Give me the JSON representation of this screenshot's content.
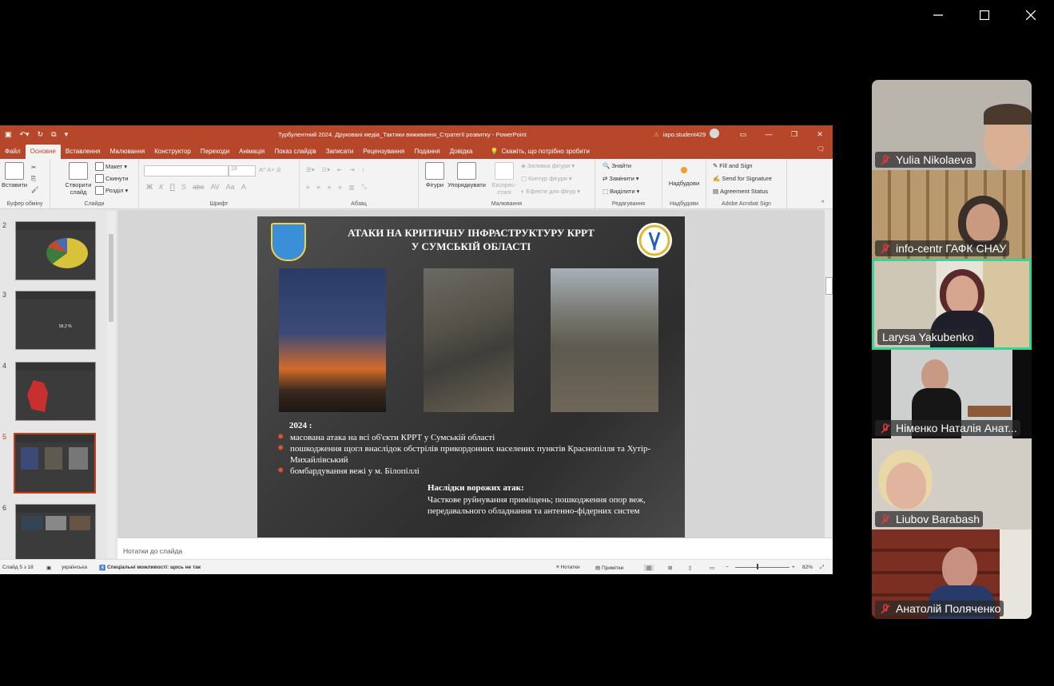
{
  "app": {
    "document_title": "Турбулентний 2024. Друковані медіа_Тактики виживання_Стратегії розвитку  -  PowerPoint",
    "user": "iapo.student429",
    "warning": "⚠"
  },
  "tabs": [
    "Файл",
    "Основне",
    "Вставлення",
    "Малювання",
    "Конструктор",
    "Переходи",
    "Анімація",
    "Показ слайдів",
    "Записати",
    "Рецензування",
    "Подання",
    "Довідка"
  ],
  "tell_me": "Скажіть, що потрібно зробити",
  "ribbon": {
    "clipboard": {
      "paste": "Вставити",
      "group": "Буфер обміну"
    },
    "slides": {
      "new": "Створити слайд",
      "layout": "Макет",
      "reset": "Скинути",
      "section": "Розділ",
      "group": "Слайди"
    },
    "font": {
      "size": "18",
      "bold": "Ж",
      "italic": "К",
      "underline": "П",
      "shadow": "S",
      "strike": "abc",
      "group": "Шрифт"
    },
    "paragraph": {
      "group": "Абзац"
    },
    "drawing": {
      "shapes": "Фігури",
      "arrange": "Упорядкувати",
      "quick_styles": "Експрес-стилі",
      "fill": "Заливка фігури",
      "outline": "Контур фігури",
      "effects": "Ефекти для фігур",
      "group": "Малювання"
    },
    "editing": {
      "find": "Знайти",
      "replace": "Замінити",
      "select": "Виділити",
      "group": "Редагування"
    },
    "addins": {
      "label": "Надбудови",
      "group": "Надбудови"
    },
    "acrobat": {
      "fill_sign": "Fill and Sign",
      "send_sig": "Send for Signature",
      "agreement": "Agreement Status",
      "group": "Adobe Acrobat Sign"
    }
  },
  "thumbnails": [
    {
      "num": "2",
      "title": "КРОСПЛАТФОРМОВІСТЬ ДРУКОВАНИХ МЕДІА"
    },
    {
      "num": "3",
      "title": "ЗАГАЛЬНА СИТУАЦІЯ",
      "value": "56,2 %"
    },
    {
      "num": "4",
      "title": "СУМСЬКА ОБЛАСТЬ"
    },
    {
      "num": "5",
      "title": "АТАКИ НА КРИТИЧНУ ІНФРАСТРУКТУРУ"
    },
    {
      "num": "6",
      "title": "МЕДІА В ОБЛАСТІ"
    }
  ],
  "slide": {
    "title_line1": "АТАКИ НА КРИТИЧНУ ІНФРАСТРУКТУРУ КРРТ",
    "title_line2": "У СУМСЬКІЙ ОБЛАСТІ",
    "year": "2024 :",
    "bullets": [
      "масована атака на всі об'єкти КРРТ у Сумській області",
      "пошкодження щогл внаслідок обстрілів прикордонних населених пунктів Краснопілля та Хутір-Михайлівський",
      "бомбардування вежі у м. Білопіллі"
    ],
    "consequences_title": "Наслідки ворожих атак:",
    "consequences_text": "Часткове руйнування приміщень; пошкодження опор веж, передавального обладнання та антенно-фідерних систем"
  },
  "notes_placeholder": "Нотатки до слайда",
  "status": {
    "slide_of": "Слайд 5 з 18",
    "language": "українська",
    "accessibility": "Спеціальні можливості: щось не так",
    "notes": "Нотатки",
    "comments": "Примітки",
    "zoom": "82%"
  },
  "participants": [
    {
      "name": "Yulia  Nikolaeva"
    },
    {
      "name": "info-centr ГАФК СНАУ"
    },
    {
      "name": "Larysa Yakubenko"
    },
    {
      "name": "Німенко Наталія Анат..."
    },
    {
      "name": "Liubov Barabash"
    },
    {
      "name": "Анатолій Поляченко"
    }
  ],
  "colors": {
    "ppt_accent": "#b7472a",
    "active_speaker": "#36d399",
    "muted": "#e03a3a"
  }
}
